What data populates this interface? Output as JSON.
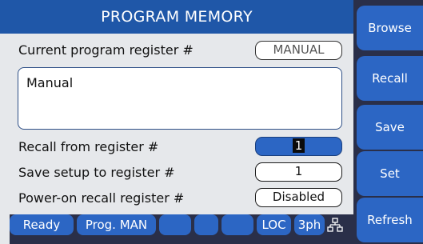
{
  "title": "PROGRAM MEMORY",
  "current_register": {
    "label": "Current program register #",
    "value": "MANUAL"
  },
  "description": "Manual",
  "recall_from": {
    "label": "Recall from register #",
    "value": "1"
  },
  "save_to": {
    "label": "Save setup to register #",
    "value": "1"
  },
  "poweron_recall": {
    "label": "Power-on recall register #",
    "value": "Disabled"
  },
  "status": {
    "ready": "Ready",
    "prog": "Prog. MAN",
    "loc": "LOC",
    "phase": "3ph"
  },
  "side_buttons": {
    "browse": "Browse",
    "recall": "Recall",
    "save": "Save",
    "set": "Set",
    "refresh": "Refresh"
  }
}
